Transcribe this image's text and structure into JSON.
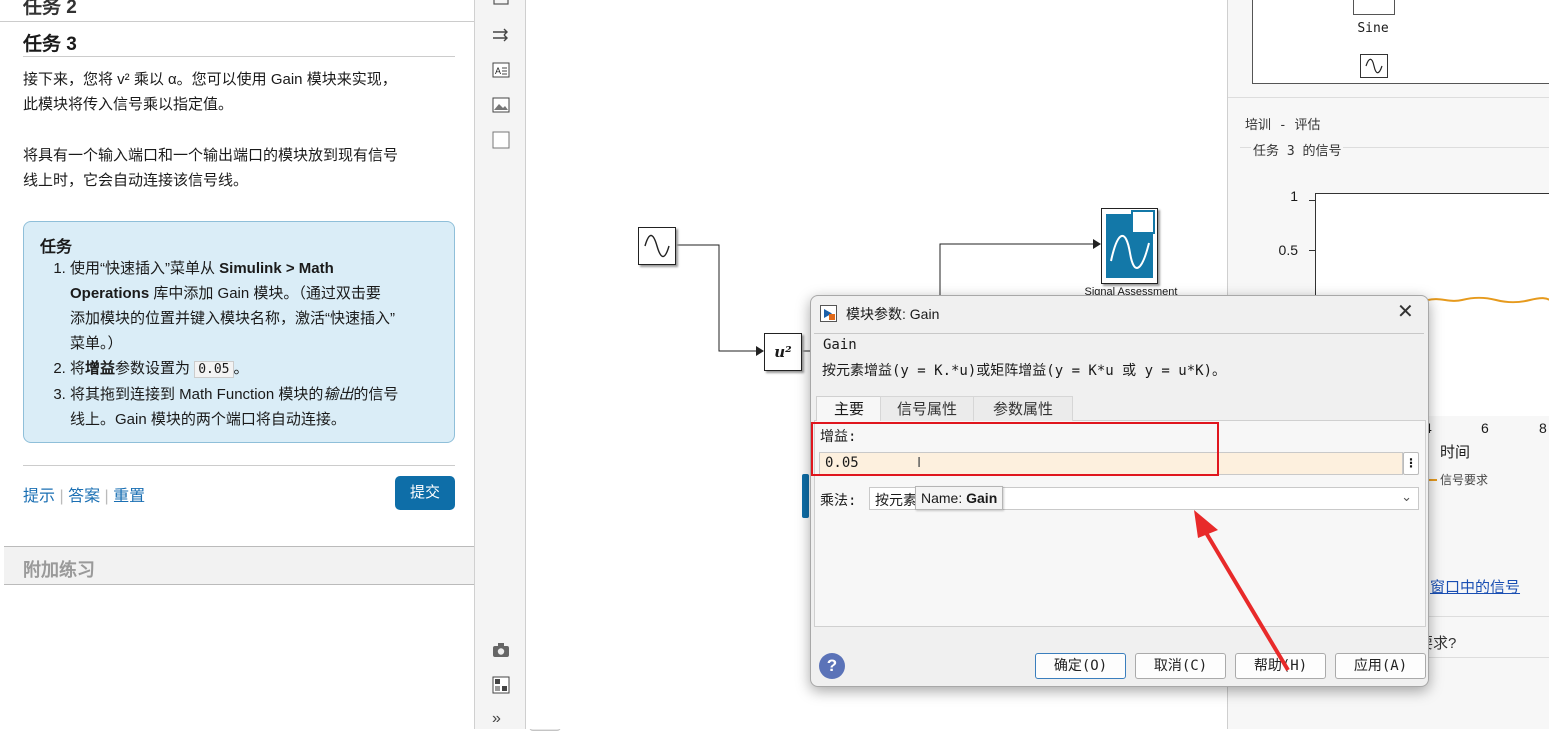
{
  "left_panel": {
    "prev_task_heading": "任务 2",
    "task_heading": "任务 3",
    "intro_1": "接下来，您将 v² 乘以 α。您可以使用 Gain 模块来实现，",
    "intro_2": "此模块将传入信号乘以指定值。",
    "para2_1": "将具有一个输入端口和一个输出端口的模块放到现有信号",
    "para2_2": "线上时，它会自动连接该信号线。",
    "task_box": {
      "title": "任务",
      "step1_a": "使用“快速插入”菜单从 ",
      "step1_b": "Simulink > Math",
      "step1_c": "Operations",
      "step1_d": " 库中添加 Gain 模块。（通过双击要",
      "step1_e": "添加模块的位置并键入模块名称，激活“快速插入”",
      "step1_f": "菜单。）",
      "step2_a": "将",
      "step2_b": "增益",
      "step2_c": "参数设置为 ",
      "step2_code": "0.05",
      "step2_d": "。",
      "step3_a": "将其拖到连接到 Math Function 模块的",
      "step3_b": "输出",
      "step3_c": "的信号",
      "step3_d": "线上。Gain 模块的两个端口将自动连接。"
    },
    "links": [
      "提示",
      "答案",
      "重置"
    ],
    "submit_label": "提交",
    "extra_heading": "附加练习"
  },
  "canvas": {
    "math_block_label": "u²",
    "assessment_label": "Signal Assessment"
  },
  "right_panel": {
    "library_label": "Sine",
    "section_title": "培训 - 评估",
    "group_title": "任务 3 的信号",
    "y_ticks": [
      "1",
      "0.5"
    ],
    "x_ticks": [
      "4",
      "6",
      "8"
    ],
    "x_label": "时间",
    "legend_label": "信号要求",
    "link_text": "窗口中的信号",
    "question_text": "要求?"
  },
  "dialog": {
    "title": "模块参数: Gain",
    "block_type": "Gain",
    "description": "按元素增益(y = K.*u)或矩阵增益(y = K*u 或 y = u*K)。",
    "tabs": [
      "主要",
      "信号属性",
      "参数属性"
    ],
    "gain_label": "增益:",
    "gain_value": "0.05",
    "multiply_label": "乘法:",
    "multiply_value": "按元素",
    "tooltip_prefix": "Name: ",
    "tooltip_name": "Gain",
    "buttons": {
      "ok": "确定(O)",
      "cancel": "取消(C)",
      "help": "帮助(H)",
      "apply": "应用(A)"
    }
  },
  "colors": {
    "accent": "#0e6ea8",
    "highlight_box": "#e0161e",
    "arrow": "#e82a2a",
    "signal_line": "#e69a1d"
  }
}
